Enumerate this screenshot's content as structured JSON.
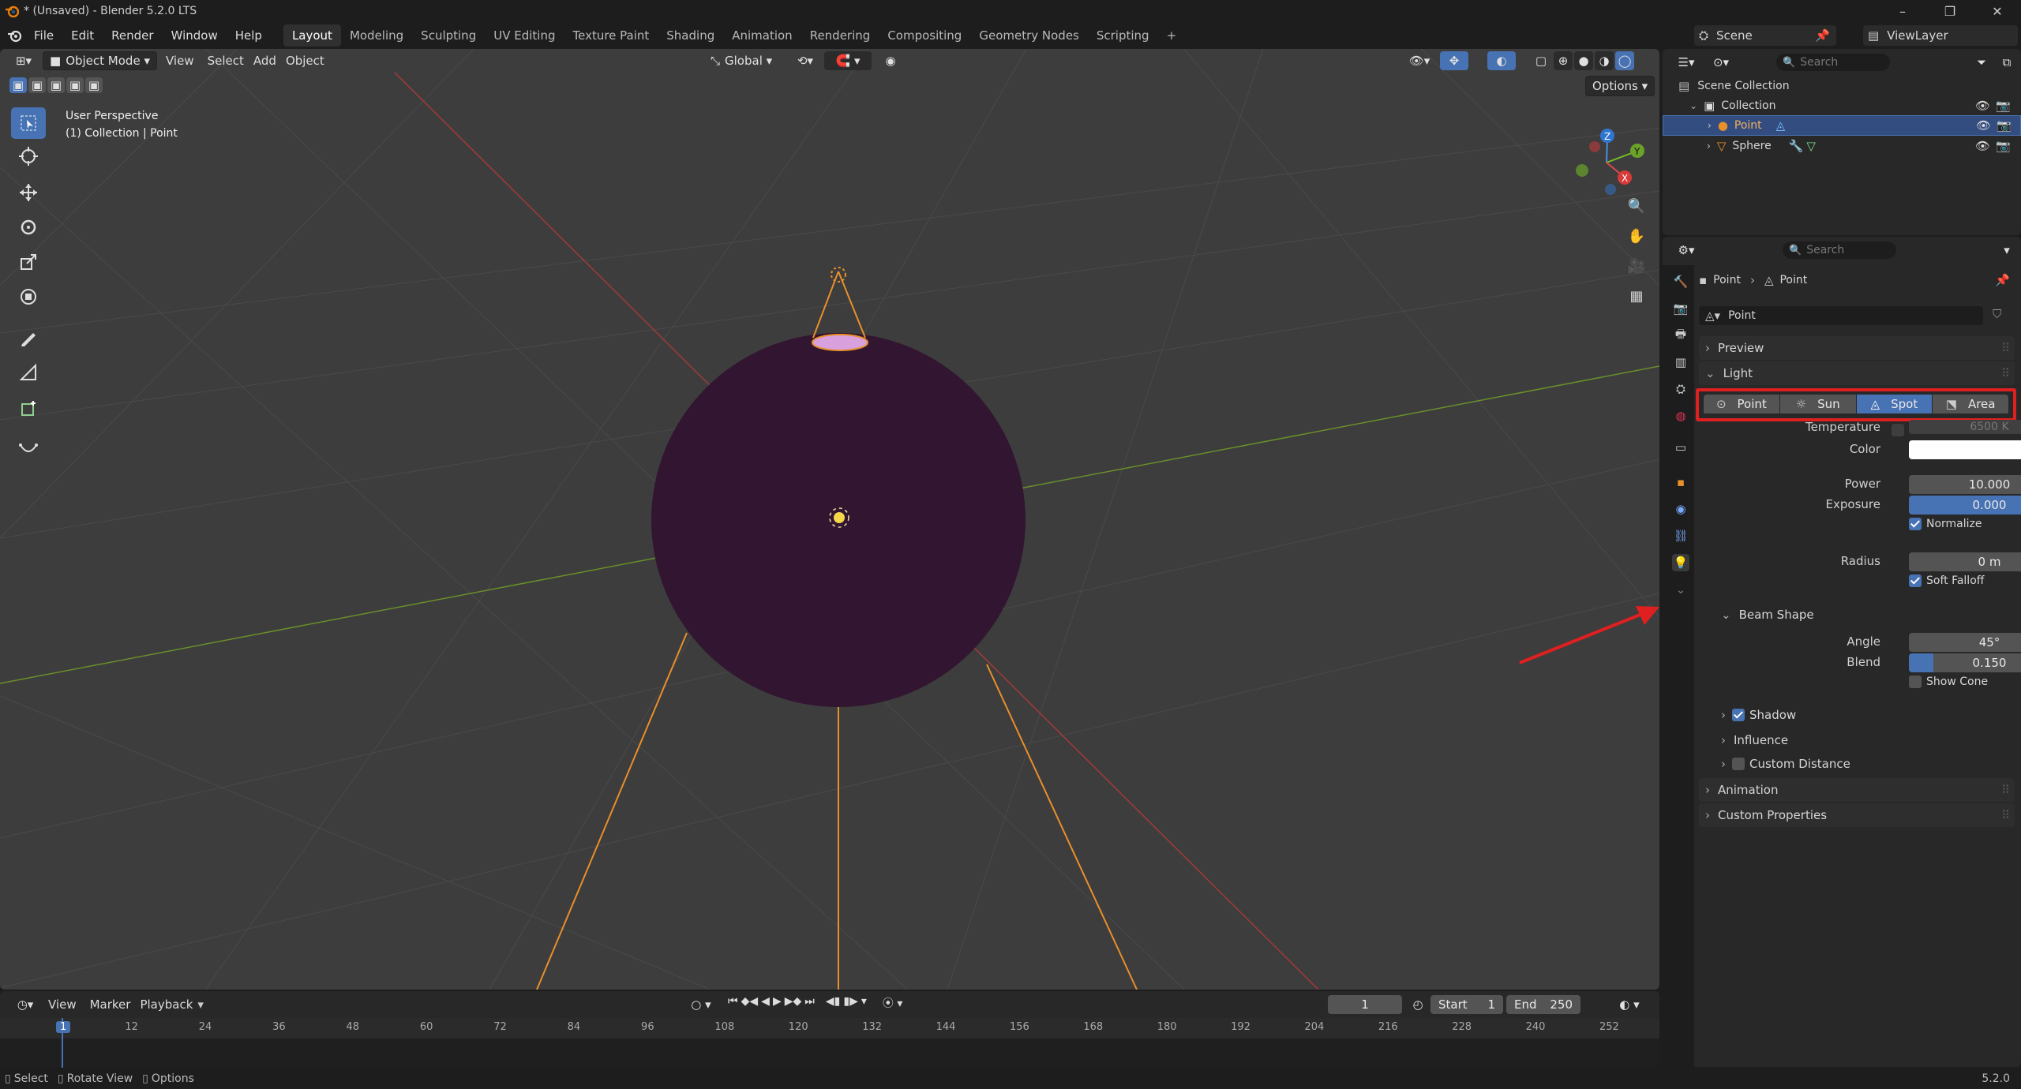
{
  "window": {
    "title": "* (Unsaved) - Blender 5.2.0 LTS",
    "minimize": "–",
    "maximize": "❐",
    "close": "✕"
  },
  "menu": {
    "items": [
      "File",
      "Edit",
      "Render",
      "Window",
      "Help"
    ]
  },
  "workspaces": [
    "Layout",
    "Modeling",
    "Sculpting",
    "UV Editing",
    "Texture Paint",
    "Shading",
    "Animation",
    "Rendering",
    "Compositing",
    "Geometry Nodes",
    "Scripting",
    "+"
  ],
  "scene": {
    "name": "Scene",
    "view_layer": "ViewLayer"
  },
  "viewport": {
    "mode": "Object Mode",
    "menus": [
      "View",
      "Select",
      "Add",
      "Object"
    ],
    "orientation": "Global",
    "options": "Options",
    "overlay_title": "User Perspective",
    "overlay_sub": "(1) Collection | Point",
    "gizmo": {
      "z": "Z",
      "y": "Y",
      "x": "X"
    }
  },
  "timeline": {
    "menus": [
      "View",
      "Marker",
      "Playback"
    ],
    "current_frame": "1",
    "start_label": "Start",
    "start": "1",
    "end_label": "End",
    "end": "250",
    "ticks": [
      "1",
      "12",
      "24",
      "36",
      "48",
      "60",
      "72",
      "84",
      "96",
      "108",
      "120",
      "132",
      "144",
      "156",
      "168",
      "180",
      "192",
      "204",
      "216",
      "228",
      "240",
      "252"
    ]
  },
  "status": {
    "select": "Select",
    "rotate": "Rotate View",
    "options": "Options",
    "version": "5.2.0"
  },
  "outliner": {
    "search_placeholder": "Search",
    "scene_collection": "Scene Collection",
    "collection": "Collection",
    "items": [
      "Point",
      "Sphere"
    ]
  },
  "properties": {
    "search_placeholder": "Search",
    "breadcrumb_object": "Point",
    "breadcrumb_data": "Point",
    "datablock": "Point",
    "sections": {
      "preview": "Preview",
      "light": "Light",
      "beam_shape": "Beam Shape",
      "shadow": "Shadow",
      "influence": "Influence",
      "custom_distance": "Custom Distance",
      "animation": "Animation",
      "custom_properties": "Custom Properties"
    },
    "light_types": [
      "Point",
      "Sun",
      "Spot",
      "Area"
    ],
    "active_light_type": "Spot",
    "temperature_label": "Temperature",
    "temperature": "6500 K",
    "color_label": "Color",
    "power_label": "Power",
    "power": "10.000",
    "exposure_label": "Exposure",
    "exposure": "0.000",
    "normalize_label": "Normalize",
    "radius_label": "Radius",
    "radius": "0 m",
    "soft_falloff_label": "Soft Falloff",
    "angle_label": "Angle",
    "angle": "45°",
    "blend_label": "Blend",
    "blend": "0.150",
    "blend_fraction": 0.15,
    "show_cone_label": "Show Cone"
  },
  "colors": {
    "accent": "#4772b3",
    "highlight_box": "#e02020",
    "arrow": "#e02020",
    "sphere": "#321530",
    "light_lines": "#e8902a"
  }
}
